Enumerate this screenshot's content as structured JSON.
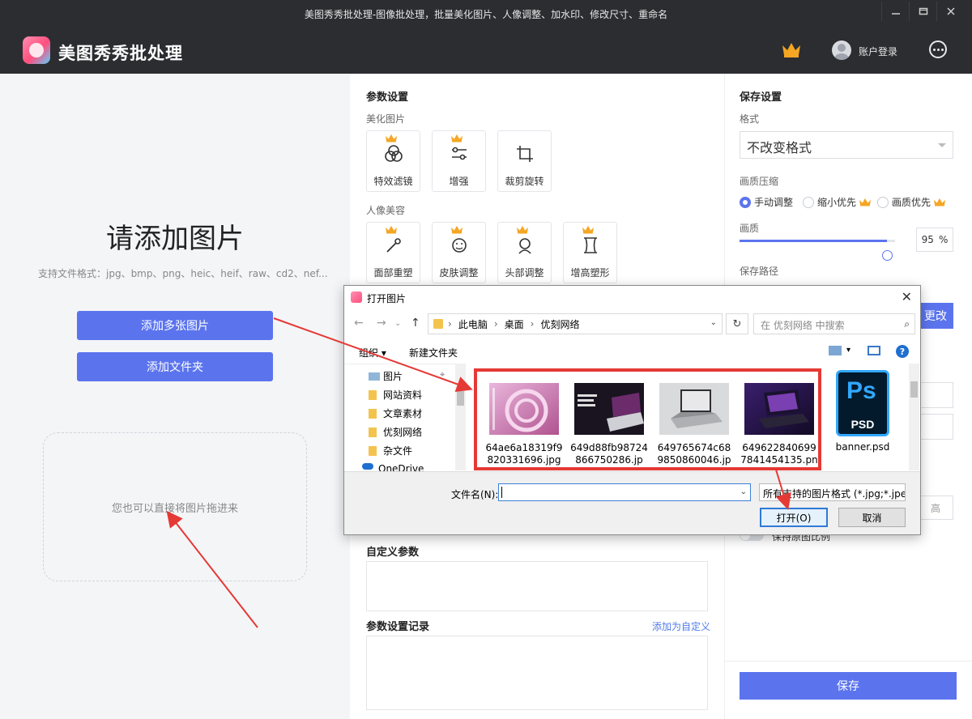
{
  "window": {
    "title": "美图秀秀批处理-图像批处理，批量美化图片、人像调整、加水印、修改尺寸、重命名",
    "app_name": "美图秀秀批处理",
    "login": "账户登录"
  },
  "left": {
    "heading": "请添加图片",
    "formats": "支持文件格式：jpg、bmp、png、heic、heif、raw、cd2、nef...",
    "add_images": "添加多张图片",
    "add_folder": "添加文件夹",
    "drop_hint": "您也可以直接将图片拖进来"
  },
  "params": {
    "title": "参数设置",
    "beautify_title": "美化图片",
    "beautify": [
      "特效滤镜",
      "增强",
      "裁剪旋转"
    ],
    "portrait_title": "人像美容",
    "portrait": [
      "面部重塑",
      "皮肤调整",
      "头部调整",
      "增高塑形"
    ],
    "custom_title": "自定义参数",
    "history_title": "参数设置记录",
    "add_custom": "添加为自定义"
  },
  "save": {
    "title": "保存设置",
    "format_label": "格式",
    "format_value": "不改变格式",
    "compress_label": "画质压缩",
    "compress_options": [
      "手动调整",
      "缩小优先",
      "画质优先"
    ],
    "quality_label": "画质",
    "quality_value": "95",
    "quality_unit": "%",
    "quality_level": 0.95,
    "path_label": "保存路径",
    "change_btn": "更改",
    "height_unit": "高",
    "keep_ratio": "保持原图比例",
    "save_btn": "保存"
  },
  "dialog": {
    "title": "打开图片",
    "breadcrumb": [
      "此电脑",
      "桌面",
      "优刻网络"
    ],
    "search_placeholder": "在 优刻网络 中搜索",
    "organize": "组织 ▾",
    "new_folder": "新建文件夹",
    "nav_items": [
      "图片",
      "网站资料",
      "文章素材",
      "优刻网络",
      "杂文件",
      "OneDrive"
    ],
    "files": [
      "64ae6a18319f9820331696.jpg",
      "649d88fb98724866750286.jp",
      "649765674c689850860046.jp",
      "6496228406997841454135.pn",
      "banner.psd"
    ],
    "filename_label": "文件名(N):",
    "filetype": "所有支持的图片格式 (*.jpg;*.jpeg",
    "open_btn": "打开(O)",
    "cancel_btn": "取消"
  },
  "colors": {
    "accent": "#5b74ee",
    "titlebar": "#2b2d31",
    "crown": "#f5a623",
    "annotation": "#e53935"
  }
}
